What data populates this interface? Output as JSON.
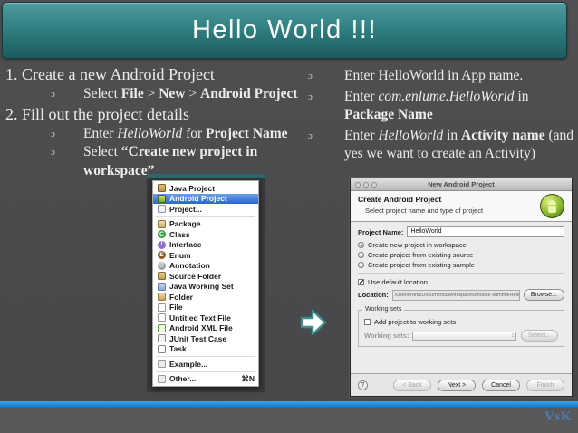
{
  "slide": {
    "title": "Hello World !!!",
    "logo": "VsK",
    "colors": {
      "banner_teal": "#2f7e80",
      "footer_blue": "#1585d8",
      "menu_selection_blue": "#3273d8",
      "logo_blue": "#4d7cb4",
      "android_green": "#8cb92f",
      "background_gray": "#4a4a4c"
    }
  },
  "left_column": {
    "item1": "1. Create a new Android Project",
    "b1": {
      "marker": "ɔ",
      "t1": "Select ",
      "t2": "File",
      "t3": " > ",
      "t4": "New",
      "t5": " > ",
      "t6": "Android Project"
    },
    "item2": "2. Fill out the project details",
    "b2": {
      "marker": "ɔ",
      "t1": "Enter ",
      "t2": "HelloWorld",
      "t3": " for ",
      "t4": "Project Name"
    },
    "b3": {
      "marker": "ɔ",
      "t1": "Select ",
      "t2": "“Create new project in workspace”"
    }
  },
  "right_column": {
    "b1": {
      "marker": "ɔ",
      "t1": "Enter HelloWorld in App name."
    },
    "b2": {
      "marker": "ɔ",
      "t1": "Enter ",
      "t2": "com.enlume.HelloWorld",
      "t3": " in ",
      "t4": "Package Name"
    },
    "b3": {
      "marker": "ɔ",
      "t1": "Enter ",
      "t2": "HelloWorld",
      "t3": " in ",
      "t4": "Activity name",
      "t5": " (and yes we want to create an Activity)"
    }
  },
  "menu": {
    "items": [
      {
        "label": "Java Project"
      },
      {
        "label": "Android Project",
        "selected": "true"
      },
      {
        "label": "Project..."
      },
      {
        "label": "Package"
      },
      {
        "label": "Class"
      },
      {
        "label": "Interface"
      },
      {
        "label": "Enum"
      },
      {
        "label": "Annotation"
      },
      {
        "label": "Source Folder"
      },
      {
        "label": "Java Working Set"
      },
      {
        "label": "Folder"
      },
      {
        "label": "File"
      },
      {
        "label": "Untitled Text File"
      },
      {
        "label": "Android XML File"
      },
      {
        "label": "JUnit Test Case"
      },
      {
        "label": "Task"
      },
      {
        "label": "Example..."
      },
      {
        "label": "Other...",
        "shortcut": "⌘N"
      }
    ]
  },
  "dialog": {
    "window_title": "New Android Project",
    "header_title": "Create Android Project",
    "header_subtitle": "Select project name and type of project",
    "project_name_label": "Project Name:",
    "project_name_value": "HelloWorld",
    "radio_workspace": "Create new project in workspace",
    "radio_existing_source": "Create project from existing source",
    "radio_existing_sample": "Create project from existing sample",
    "use_default_location": "Use default location",
    "location_label": "Location:",
    "location_value": "/Users/rohit/Documents/workspaces/mobile-summit/HelloW",
    "browse_button": "Browse...",
    "working_sets_group": "Working sets",
    "add_to_working_sets": "Add project to working sets",
    "working_sets_label": "Working sets:",
    "select_button": "Select...",
    "help_button": "?",
    "back_button": "< Back",
    "next_button": "Next >",
    "cancel_button": "Cancel",
    "finish_button": "Finish"
  }
}
